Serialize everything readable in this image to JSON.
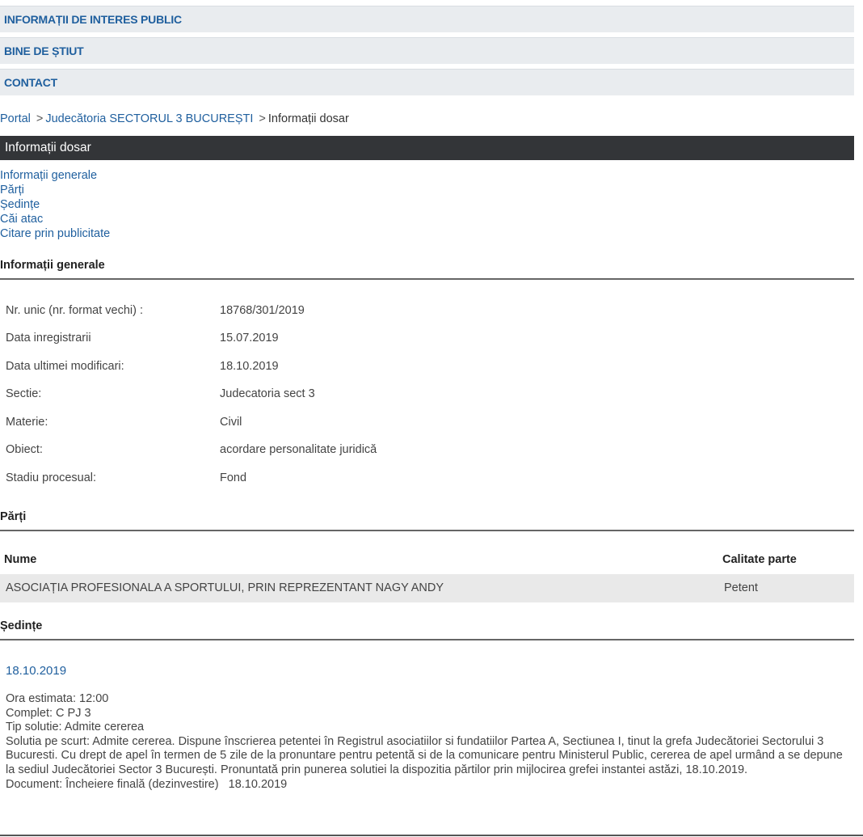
{
  "nav": {
    "items": [
      "INFORMAȚII DE INTERES PUBLIC",
      "BINE DE ȘTIUT",
      "CONTACT"
    ]
  },
  "breadcrumb": {
    "portal": "Portal",
    "court": "Judecătoria SECTORUL 3 BUCUREȘTI",
    "current": "Informații dosar",
    "separator": ">"
  },
  "page_title": "Informații dosar",
  "tabs": [
    "Informații generale",
    "Părți",
    "Ședințe",
    "Căi atac",
    "Citare prin publicitate"
  ],
  "info": {
    "heading": "Informații generale",
    "rows": [
      {
        "label": "Nr. unic (nr. format vechi) :",
        "value": "18768/301/2019"
      },
      {
        "label": "Data inregistrarii",
        "value": "15.07.2019"
      },
      {
        "label": "Data ultimei modificari:",
        "value": "18.10.2019"
      },
      {
        "label": "Sectie:",
        "value": "Judecatoria sect 3"
      },
      {
        "label": "Materie:",
        "value": "Civil"
      },
      {
        "label": "Obiect:",
        "value": "acordare personalitate juridică"
      },
      {
        "label": "Stadiu procesual:",
        "value": "Fond"
      }
    ]
  },
  "parti": {
    "heading": "Părți",
    "columns": [
      "Nume",
      "Calitate parte"
    ],
    "rows": [
      {
        "name": "ASOCIAȚIA PROFESIONALA A SPORTULUI, PRIN REPREZENTANT NAGY ANDY",
        "role": "Petent"
      }
    ]
  },
  "sedinte": {
    "heading": "Ședințe",
    "date": "18.10.2019",
    "ora": "Ora estimata: 12:00",
    "complet": "Complet: C PJ 3",
    "tip": "Tip solutie: Admite cererea",
    "solutie": "Solutia pe scurt: Admite cererea. Dispune înscrierea petentei în Registrul asociatiilor si fundatiilor Partea A, Sectiunea I, tinut la grefa Judecătoriei Sectorului 3 Bucuresti. Cu drept de apel în termen de 5 zile de la pronuntare pentru petentă si de la comunicare pentru Ministerul Public, cererea de apel urmând a se depune la sediul Judecătoriei Sector 3 București. Pronuntată prin punerea solutiei la dispozitia părtilor prin mijlocirea grefei instantei astăzi, 18.10.2019.",
    "document": "Document: Încheiere finală (dezinvestire)   18.10.2019"
  },
  "colors": {
    "link": "#1f5f9e",
    "nav_bg": "#e9ecef",
    "title_bar": "#333538",
    "row_bg": "#e9e9e9"
  }
}
